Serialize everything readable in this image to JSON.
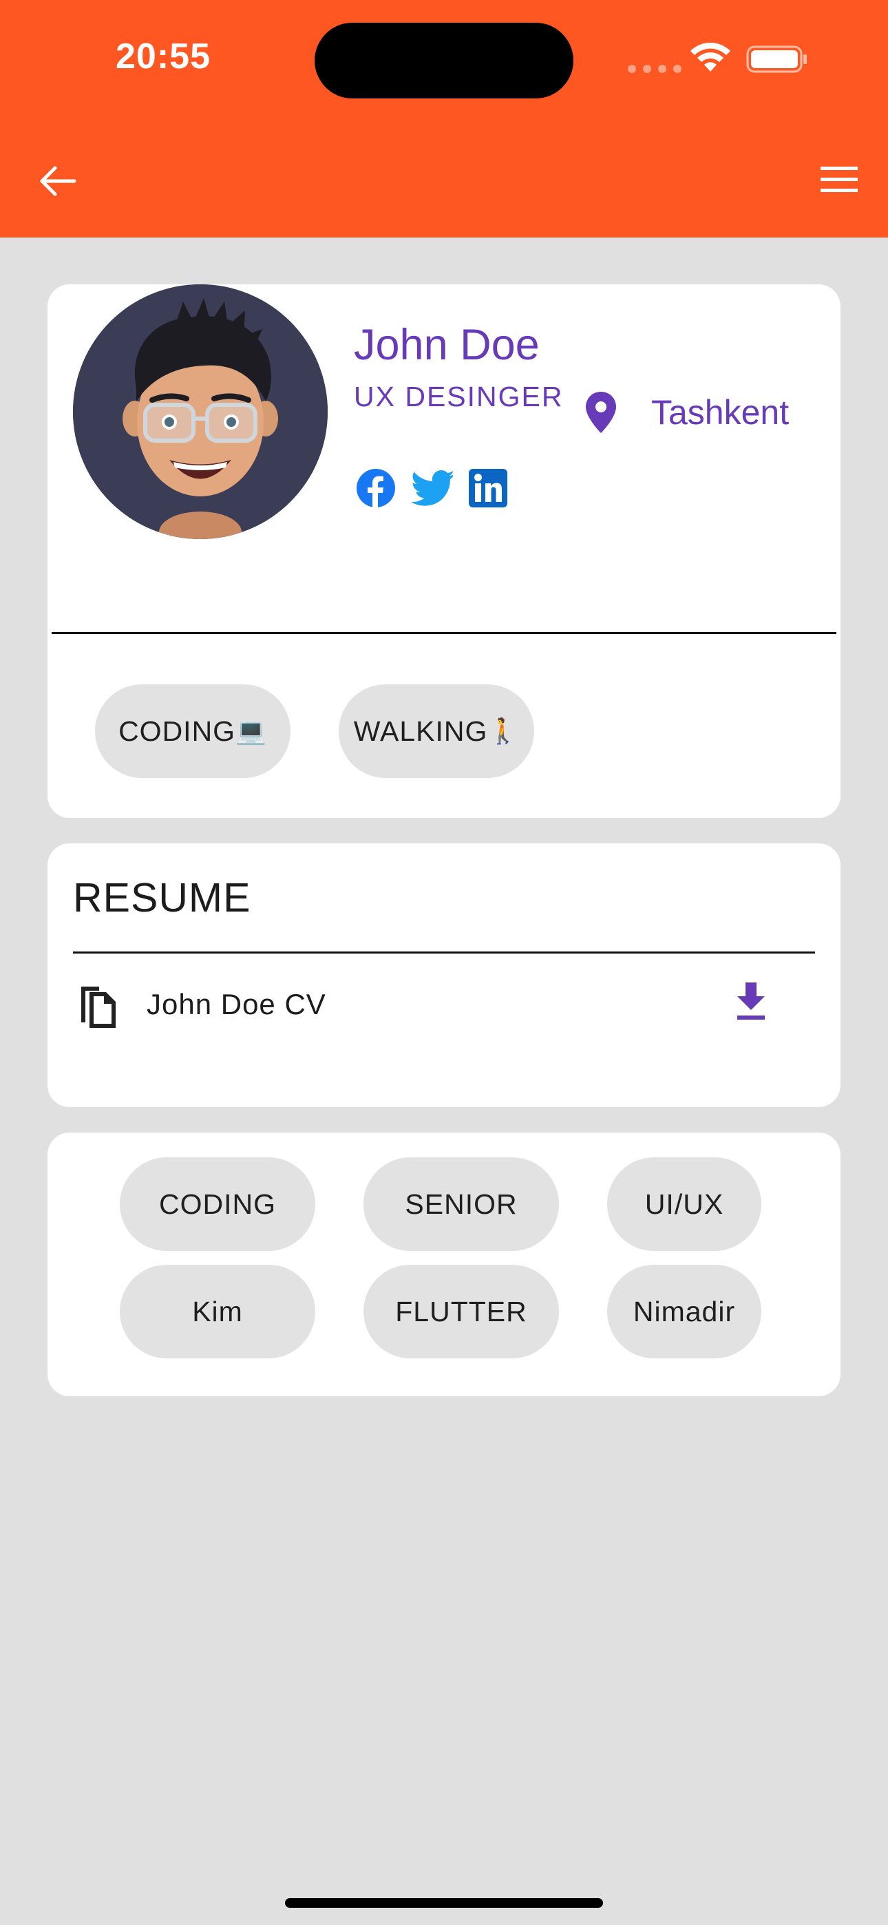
{
  "status_bar": {
    "time": "20:55"
  },
  "app_bar": {
    "background_color": "#ff5722",
    "back_icon": "arrow-back-icon",
    "menu_icon": "hamburger-menu-icon"
  },
  "profile": {
    "name": "John Doe",
    "title": "UX DESINGER",
    "location": "Tashkent",
    "accent_color": "#673ab7",
    "social": [
      {
        "name": "facebook-icon",
        "color": "#1877f2"
      },
      {
        "name": "twitter-icon",
        "color": "#1da1f2"
      },
      {
        "name": "linkedin-icon",
        "color": "#0a66c2"
      }
    ],
    "hobbies": [
      {
        "label": "CODING",
        "emoji": "💻"
      },
      {
        "label": "WALKING",
        "emoji": "🚶"
      }
    ]
  },
  "resume": {
    "title": "RESUME",
    "file_name": "John Doe CV",
    "file_icon": "file-copy-icon",
    "download_icon": "download-icon"
  },
  "tags": [
    "CODING",
    "SENIOR",
    "UI/UX",
    "Kim",
    "FLUTTER",
    "Nimadir"
  ]
}
